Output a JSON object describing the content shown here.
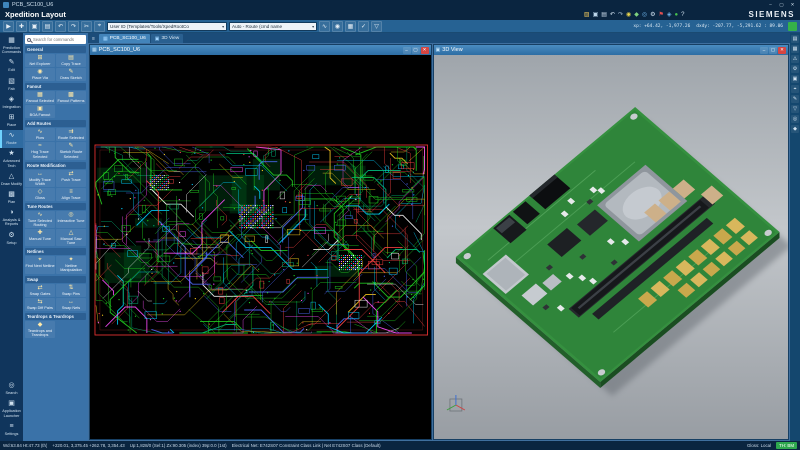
{
  "theme": {
    "accent_blue": "#266293",
    "panel_blue": "#3a72a8",
    "navy": "#0a2540",
    "status_green": "#2ea84e",
    "board_green": "#35903f"
  },
  "titlebar": {
    "title": "PCB_SC100_U6",
    "controls": {
      "minimize": "–",
      "maximize": "▢",
      "close": "✕"
    }
  },
  "menubar": {
    "app_title": "Xpedition Layout",
    "brand": "SIEMENS",
    "icons": [
      {
        "name": "open-file-icon",
        "glyph": "▨",
        "color": "#e8c25b"
      },
      {
        "name": "save-icon",
        "glyph": "▣",
        "color": "#bcd6ea"
      },
      {
        "name": "print-icon",
        "glyph": "▤",
        "color": "#cfe0ee"
      },
      {
        "name": "undo-icon",
        "glyph": "↶",
        "color": "#cfe0ee"
      },
      {
        "name": "redo-icon",
        "glyph": "↷",
        "color": "#9fb8cc"
      },
      {
        "name": "lock-icon",
        "glyph": "◉",
        "color": "#e8d44d"
      },
      {
        "name": "protect-icon",
        "glyph": "◆",
        "color": "#7fd37f"
      },
      {
        "name": "globe-icon",
        "glyph": "◎",
        "color": "#6db3e8"
      },
      {
        "name": "gear-icon",
        "glyph": "⚙",
        "color": "#cfe0ee"
      },
      {
        "name": "flag-icon",
        "glyph": "⚑",
        "color": "#e05050"
      },
      {
        "name": "info-icon",
        "glyph": "◈",
        "color": "#6db3e8"
      },
      {
        "name": "status-dot-icon",
        "glyph": "●",
        "color": "#47c24e"
      },
      {
        "name": "help-icon",
        "glyph": "?",
        "color": "#cfe0ee"
      }
    ]
  },
  "toolbar": {
    "left_icons": [
      {
        "name": "select-tool-icon",
        "glyph": "▶"
      },
      {
        "name": "add-item-icon",
        "glyph": "✚"
      },
      {
        "name": "save-icon",
        "glyph": "▣"
      },
      {
        "name": "sheet-icon",
        "glyph": "▤"
      },
      {
        "name": "undo-icon",
        "glyph": "↶"
      },
      {
        "name": "redo-icon",
        "glyph": "↷"
      },
      {
        "name": "cut-icon",
        "glyph": "✂"
      },
      {
        "name": "origin-icon",
        "glyph": "⌖"
      }
    ],
    "combo1": "User ID (Templates/Tools/XpedRootCo",
    "combo2": "Auto - Route (cmd name",
    "mid_icons": [
      {
        "name": "route-mode-icon",
        "glyph": "∿"
      },
      {
        "name": "pad-entry-icon",
        "glyph": "◉"
      },
      {
        "name": "grid-toggle-icon",
        "glyph": "▦"
      },
      {
        "name": "drc-check-icon",
        "glyph": "✓"
      },
      {
        "name": "filter-icon",
        "glyph": "▽"
      }
    ],
    "readout1": "xp: +64.42, -1,977.26",
    "readout2": "dxdy: -207.77, -5,291.62 : 89.06"
  },
  "navrail": {
    "items": [
      {
        "label": "Prediction Commands",
        "glyph": "▦",
        "active": false,
        "bottom": false
      },
      {
        "label": "Edit",
        "glyph": "✎",
        "active": false,
        "bottom": false
      },
      {
        "label": "Fab",
        "glyph": "▧",
        "active": false,
        "bottom": false
      },
      {
        "label": "Integration",
        "glyph": "◈",
        "active": false,
        "bottom": false
      },
      {
        "label": "Place",
        "glyph": "⊞",
        "active": false,
        "bottom": false
      },
      {
        "label": "Route",
        "glyph": "∿",
        "active": true,
        "bottom": false
      },
      {
        "label": "Advanced Tech",
        "glyph": "★",
        "active": false,
        "bottom": false
      },
      {
        "label": "Draw Modify",
        "glyph": "△",
        "active": false,
        "bottom": false
      },
      {
        "label": "Plan",
        "glyph": "▩",
        "active": false,
        "bottom": false
      },
      {
        "label": "Analysis & Reports",
        "glyph": "◑",
        "active": false,
        "bottom": false
      },
      {
        "label": "Setup",
        "glyph": "⚙",
        "active": false,
        "bottom": false
      },
      {
        "label": "Search",
        "glyph": "◎",
        "active": false,
        "bottom": true
      },
      {
        "label": "Application Launcher",
        "glyph": "▣",
        "active": false,
        "bottom": true
      },
      {
        "label": "Settings",
        "glyph": "≡",
        "active": false,
        "bottom": true
      }
    ]
  },
  "command_panel": {
    "search_placeholder": "Search for commands",
    "sections": [
      {
        "title": "General",
        "buttons": [
          {
            "label": "Net Explorer",
            "glyph": "⊞"
          },
          {
            "label": "Copy Trace",
            "glyph": "▤"
          },
          {
            "label": "Place Via",
            "glyph": "◉"
          },
          {
            "label": "Draw Sketch",
            "glyph": "✎"
          }
        ]
      },
      {
        "title": "Fanout",
        "buttons": [
          {
            "label": "Fanout Selected",
            "glyph": "▦"
          },
          {
            "label": "Fanout Patterns",
            "glyph": "▩"
          },
          {
            "label": "BGA Fanout",
            "glyph": "▣"
          }
        ]
      },
      {
        "title": "Add Routes",
        "buttons": [
          {
            "label": "Plow",
            "glyph": "∿"
          },
          {
            "label": "Route Selected",
            "glyph": "⇉"
          },
          {
            "label": "Hug Trace Selected",
            "glyph": "≈"
          },
          {
            "label": "Sketch Route Selected",
            "glyph": "✎"
          }
        ]
      },
      {
        "title": "Route Modification",
        "buttons": [
          {
            "label": "Modify Trace Width",
            "glyph": "↔"
          },
          {
            "label": "Push Trace",
            "glyph": "⇄"
          },
          {
            "label": "Gloss",
            "glyph": "◇"
          },
          {
            "label": "Align Trace",
            "glyph": "≡"
          }
        ]
      },
      {
        "title": "Tune Routes",
        "buttons": [
          {
            "label": "Tune Selected Routing",
            "glyph": "∿"
          },
          {
            "label": "Interactive Tune",
            "glyph": "◎"
          },
          {
            "label": "Manual Tune",
            "glyph": "✚"
          },
          {
            "label": "Manual Saw Tune",
            "glyph": "△"
          }
        ]
      },
      {
        "title": "Netlines",
        "buttons": [
          {
            "label": "Find Next Netline",
            "glyph": "⌖"
          },
          {
            "label": "Netline Manipulation",
            "glyph": "✦"
          }
        ]
      },
      {
        "title": "Swap",
        "buttons": [
          {
            "label": "Swap Gates",
            "glyph": "⇄"
          },
          {
            "label": "Swap Pins",
            "glyph": "⇅"
          },
          {
            "label": "Swap Diff Pairs",
            "glyph": "⇆"
          },
          {
            "label": "Swap Nets",
            "glyph": "↔"
          }
        ]
      },
      {
        "title": "Teardrops & Teardrops",
        "buttons": [
          {
            "label": "Teardrops and Teardrops",
            "glyph": "◆"
          }
        ]
      }
    ]
  },
  "doc_tabs": [
    {
      "label": "PCB_SC100_U6",
      "glyph": "▦",
      "active": true
    },
    {
      "label": "3D View",
      "glyph": "▣",
      "active": false
    }
  ],
  "windows": {
    "pcb": {
      "title": "PCB_SC100_U6"
    },
    "view3d": {
      "title": "3D View"
    }
  },
  "right_rail": {
    "icons": [
      {
        "name": "display-control-icon",
        "glyph": "▤"
      },
      {
        "name": "layers-icon",
        "glyph": "▦"
      },
      {
        "name": "hazards-icon",
        "glyph": "⚠"
      },
      {
        "name": "editor-control-icon",
        "glyph": "⚙"
      },
      {
        "name": "view-3d-icon",
        "glyph": "▣"
      },
      {
        "name": "measure-icon",
        "glyph": "⌖"
      },
      {
        "name": "notes-icon",
        "glyph": "✎"
      },
      {
        "name": "filter-icon",
        "glyph": "▽"
      },
      {
        "name": "search-panel-icon",
        "glyph": "◎"
      },
      {
        "name": "pin-panel-icon",
        "glyph": "◆"
      }
    ]
  },
  "statusbar": {
    "segments": [
      "Wd:63.84  Ht:47.73 (th)",
      "+220.01, 3,375.45   +262.78, 3,354.43",
      "Up:1,828/0 (Sel:1)  Zx:90.305 (index)  39p:0.0 (1st)",
      "Electrical Net: E742S07 Constraint Class Link | Net E742S07 Class (Default)",
      "Gloss: Local"
    ],
    "badge": "TH: BM"
  },
  "pcb_view": {
    "outline_color": "#e03030",
    "pour_color": "#007828",
    "trace_colors": [
      "#21d421",
      "#00b87a",
      "#ff4242",
      "#00cfff",
      "#ff4dff",
      "#ffd21f",
      "#4f6bff",
      "#ffffff"
    ],
    "trace_weights": [
      0.34,
      0.1,
      0.15,
      0.12,
      0.1,
      0.08,
      0.08,
      0.03
    ]
  }
}
